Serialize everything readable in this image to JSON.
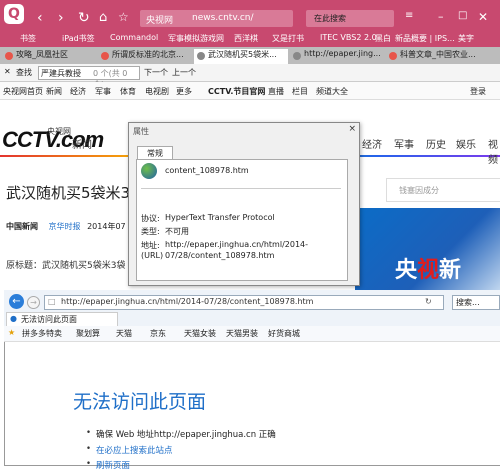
{
  "browser": {
    "title_url": "news.cntv.cn/",
    "site_label": "央视网",
    "search_placeholder": "在此搜索",
    "bookmarks": [
      "书签",
      "iPad书签",
      "Commandol",
      "军事模拟游戏网",
      "西洋棋",
      "又是打书",
      "ITEC VBS2 2.0",
      "黑白",
      "新品概要 | IPS...",
      "美字"
    ],
    "tabs": [
      "攻略_凤凰社区",
      "所谓反标准的北京...",
      "武汉随机买5袋米...",
      "http://epaper.jing...",
      "科普文章_中国农业..."
    ],
    "find_label": "查找",
    "find_value": "严建兵教授",
    "find_count": "0 个(共 0 个)",
    "find_next": "下一个",
    "find_prev": "上一个"
  },
  "site": {
    "nav": [
      "央视网首页",
      "新闻",
      "经济",
      "军事",
      "体育",
      "电视剧",
      "更多",
      "CCTV.节目官网",
      "直播",
      "栏目",
      "频道大全"
    ],
    "login": "登录",
    "logo_text": "CCTV.com",
    "logo_sub": "央视网",
    "logo_news": "新闻",
    "right_nav": [
      "经济",
      "军事",
      "历史",
      "娱乐",
      "视频"
    ],
    "headline": "武汉随机买5袋米3",
    "search_placeholder": "钱塞因成分",
    "source_label": "中国新闻",
    "source_org": "京华时报",
    "date": "2014年07",
    "share": "享",
    "original_prefix": "原标题：武汉随机买5袋米3袋",
    "banner_text": "央视新"
  },
  "dialog": {
    "title": "属性",
    "tab": "常规",
    "filename": "content_108978.htm",
    "protocol_label": "协议:",
    "protocol_value": "HyperText Transfer Protocol",
    "type_label": "类型:",
    "type_value": "不可用",
    "address_label": "地址:",
    "address_label2": "(URL)",
    "address_value_1": "http://epaper.jinghua.cn/html/2014-",
    "address_value_2": "07/28/content_108978.htm",
    "close": "×"
  },
  "ie": {
    "url": "http://epaper.jinghua.cn/html/2014-07/28/content_108978.htm",
    "search_label": "搜索...",
    "tab_label": "无法访问此页面",
    "favorites": [
      "拼多多特卖",
      "聚划算",
      "天猫",
      "京东",
      "天猫女装",
      "天猫男装",
      "好货商城"
    ],
    "error_title": "无法访问此页面",
    "error_items": [
      "确保 Web 地址http://epaper.jinghua.cn 正确",
      "在必应上搜索此站点",
      "刷新页面"
    ]
  }
}
